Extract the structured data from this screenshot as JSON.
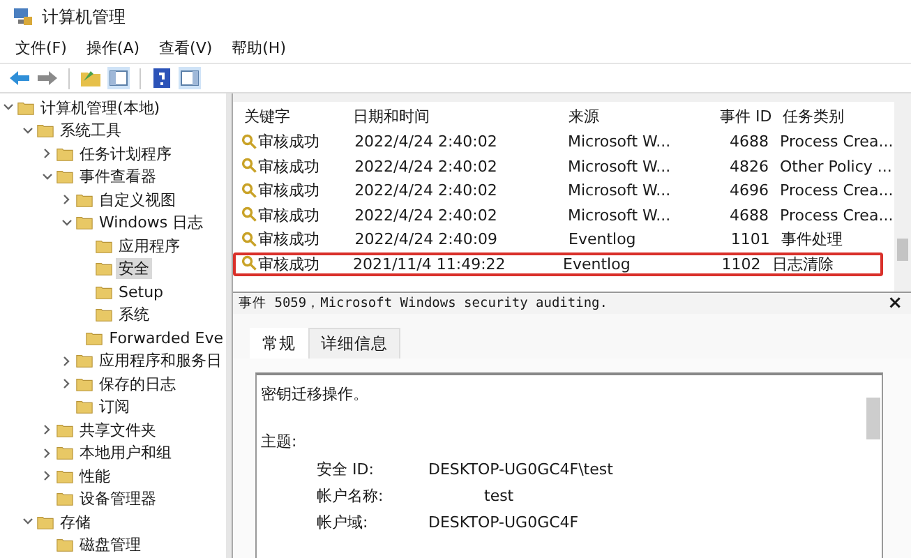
{
  "window": {
    "title": "计算机管理"
  },
  "menu": [
    "文件(F)",
    "操作(A)",
    "查看(V)",
    "帮助(H)"
  ],
  "tree": [
    {
      "label": "计算机管理(本地)",
      "selected": false,
      "expanded": true,
      "children": [
        {
          "label": "系统工具",
          "selected": false,
          "expanded": true,
          "children": [
            {
              "label": "任务计划程序",
              "selected": false,
              "expanded": false
            },
            {
              "label": "事件查看器",
              "selected": false,
              "expanded": true,
              "children": [
                {
                  "label": "自定义视图",
                  "selected": false,
                  "expanded": false
                },
                {
                  "label": "Windows 日志",
                  "selected": false,
                  "expanded": true,
                  "children": [
                    {
                      "label": "应用程序",
                      "selected": false
                    },
                    {
                      "label": "安全",
                      "selected": true
                    },
                    {
                      "label": "Setup",
                      "selected": false
                    },
                    {
                      "label": "系统",
                      "selected": false
                    },
                    {
                      "label": "Forwarded Eve",
                      "selected": false
                    }
                  ]
                },
                {
                  "label": "应用程序和服务日",
                  "selected": false,
                  "expanded": false
                },
                {
                  "label": "保存的日志",
                  "selected": false,
                  "expanded": false
                },
                {
                  "label": "订阅",
                  "selected": false
                }
              ]
            },
            {
              "label": "共享文件夹",
              "selected": false,
              "expanded": false
            },
            {
              "label": "本地用户和组",
              "selected": false,
              "expanded": false
            },
            {
              "label": "性能",
              "selected": false,
              "expanded": false
            },
            {
              "label": "设备管理器",
              "selected": false
            }
          ]
        },
        {
          "label": "存储",
          "selected": false,
          "expanded": true,
          "children": [
            {
              "label": "磁盘管理",
              "selected": false
            }
          ]
        }
      ]
    }
  ],
  "table": {
    "columns": [
      "关键字",
      "日期和时间",
      "来源",
      "事件 ID",
      "任务类别"
    ],
    "rows": [
      {
        "cells": [
          "审核成功",
          "2022/4/24 2:40:02",
          "Microsoft W...",
          "4688",
          "Process Crea..."
        ],
        "highlighted": false
      },
      {
        "cells": [
          "审核成功",
          "2022/4/24 2:40:02",
          "Microsoft W...",
          "4826",
          "Other Policy ..."
        ],
        "highlighted": false
      },
      {
        "cells": [
          "审核成功",
          "2022/4/24 2:40:02",
          "Microsoft W...",
          "4696",
          "Process Crea..."
        ],
        "highlighted": false
      },
      {
        "cells": [
          "审核成功",
          "2022/4/24 2:40:02",
          "Microsoft W...",
          "4688",
          "Process Crea..."
        ],
        "highlighted": false
      },
      {
        "cells": [
          "审核成功",
          "2022/4/24 2:40:09",
          "Eventlog",
          "1101",
          "事件处理"
        ],
        "highlighted": false
      },
      {
        "cells": [
          "审核成功",
          "2021/11/4 11:49:22",
          "Eventlog",
          "1102",
          "日志清除"
        ],
        "highlighted": true
      }
    ]
  },
  "detail": {
    "title": "事件 5059，Microsoft Windows security auditing.",
    "close": "×",
    "tabs": [
      {
        "label": "常规",
        "selected": true
      },
      {
        "label": "详细信息",
        "selected": false
      }
    ],
    "description": "密钥迁移操作。",
    "section": "主题:",
    "fields": [
      {
        "label": "安全 ID:",
        "value": "DESKTOP-UG0GC4F\\test"
      },
      {
        "label": "帐户名称:",
        "value": "test"
      },
      {
        "label": "帐户域:",
        "value": "DESKTOP-UG0GC4F"
      }
    ]
  }
}
